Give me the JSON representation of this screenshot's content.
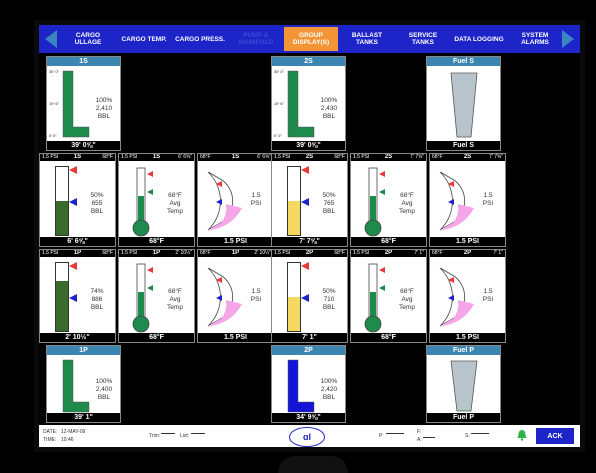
{
  "nav": {
    "items": [
      {
        "label": "CARGO ULLAGE",
        "state": "normal"
      },
      {
        "label": "CARGO TEMP.",
        "state": "normal"
      },
      {
        "label": "CARGO PRESS.",
        "state": "normal"
      },
      {
        "label": "PUMP & MANIFOLD",
        "state": "disabled"
      },
      {
        "label": "GROUP DISPLAY(S)",
        "state": "active"
      },
      {
        "label": "BALLAST TANKS",
        "state": "normal"
      },
      {
        "label": "SERVICE TANKS",
        "state": "normal"
      },
      {
        "label": "DATA LOGGING",
        "state": "normal"
      },
      {
        "label": "SYSTEM ALARMS",
        "state": "normal"
      }
    ]
  },
  "colors": {
    "nav_bg": "#1d24c8",
    "active": "#f39436",
    "header": "#3a86b0",
    "dark_green": "#3a6b2a",
    "teal_green": "#1e8a4c",
    "yellow": "#f4d862",
    "blue": "#1414d6",
    "pink": "#f4a6e8"
  },
  "row1": {
    "s1": {
      "title": "1S",
      "pct": "100%",
      "vol": "2,410",
      "unit": "BBL",
      "footer": "39' 0⅝\"",
      "fill_fraction": 1.0,
      "ticks": [
        "39' 0\"",
        "19' 6\"",
        "0' 0\""
      ]
    },
    "s2": {
      "title": "2S",
      "pct": "100%",
      "vol": "2,430",
      "unit": "BBL",
      "footer": "39' 0⅝\"",
      "fill_fraction": 1.0,
      "ticks": [
        "39' 0\"",
        "19' 6\"",
        "0' 0\""
      ]
    },
    "fuel": {
      "title": "Fuel S",
      "footer": "Fuel S"
    }
  },
  "row2": {
    "ullage_1s": {
      "title": "1S",
      "left": "1.5 PSI",
      "right": "68°F",
      "pct": "50%",
      "vol": "655",
      "unit": "BBL",
      "footer": "6' 6⅝\"",
      "fill_fraction": 0.5
    },
    "temp_1s": {
      "title": "1S",
      "left": "1.5 PSI",
      "right": "6' 6⅝\"",
      "temp": "68°F",
      "label1": "Avg",
      "label2": "Temp",
      "footer": "68°F"
    },
    "press_1s": {
      "title": "1S",
      "left": "68°F",
      "right": "6' 6⅝\"",
      "value": "1.5",
      "unit": "PSI",
      "footer": "1.5 PSI"
    },
    "ullage_2s": {
      "title": "2S",
      "left": "1.5 PSI",
      "right": "68°F",
      "pct": "50%",
      "vol": "765",
      "unit": "BBL",
      "footer": "7' 7⅝\"",
      "fill_fraction": 0.5
    },
    "temp_2s": {
      "title": "2S",
      "left": "1.5 PSI",
      "right": "7' 7⅝\"",
      "temp": "68°F",
      "label1": "Avg",
      "label2": "Temp",
      "footer": "68°F"
    },
    "press_2s": {
      "title": "2S",
      "left": "68°F",
      "right": "7' 7⅝\"",
      "value": "1.5",
      "unit": "PSI",
      "footer": "1.5 PSI"
    }
  },
  "row3": {
    "ullage_1p": {
      "title": "1P",
      "left": "1.5 PSI",
      "right": "68°F",
      "pct": "74%",
      "vol": "886",
      "unit": "BBL",
      "footer": "2' 10½\"",
      "fill_fraction": 0.74
    },
    "temp_1p": {
      "title": "1P",
      "left": "1.5 PSI",
      "right": "2' 10½\"",
      "temp": "68°F",
      "label1": "Avg",
      "label2": "Temp",
      "footer": "68°F"
    },
    "press_1p": {
      "title": "1P",
      "left": "68°F",
      "right": "2' 10½\"",
      "value": "1.5",
      "unit": "PSI",
      "footer": "1.5 PSI"
    },
    "ullage_2p": {
      "title": "2P",
      "left": "1.5 PSI",
      "right": "68°F",
      "pct": "50%",
      "vol": "710",
      "unit": "BBL",
      "footer": "7' 1\"",
      "fill_fraction": 0.5
    },
    "temp_2p": {
      "title": "2P",
      "left": "1.5 PSI",
      "right": "7' 1\"",
      "temp": "68°F",
      "label1": "Avg",
      "label2": "Temp",
      "footer": "68°F"
    },
    "press_2p": {
      "title": "2P",
      "left": "68°F",
      "right": "7' 1\"",
      "value": "1.5",
      "unit": "PSI",
      "footer": "1.5 PSI"
    }
  },
  "row4": {
    "p1": {
      "title": "1P",
      "pct": "100%",
      "vol": "2,400",
      "unit": "BBL",
      "footer": "39' 1\"",
      "fill_fraction": 1.0
    },
    "p2": {
      "title": "2P",
      "pct": "100%",
      "vol": "2,420",
      "unit": "BBL",
      "footer": "34' 9⅝\"",
      "fill_fraction": 1.0
    },
    "fuel": {
      "title": "Fuel P",
      "footer": "Fuel P"
    }
  },
  "status": {
    "date_label": "DATE:",
    "date_value": "12-MAY-09",
    "time_label": "TIME:",
    "time_value": "10:46",
    "trim_label": "Trim:",
    "list_label": "List:",
    "p_label": "P:",
    "f_label": "F:",
    "a_label": "A:",
    "s_label": "S:",
    "ack_label": "ACK",
    "logo_text": "ɑl"
  }
}
